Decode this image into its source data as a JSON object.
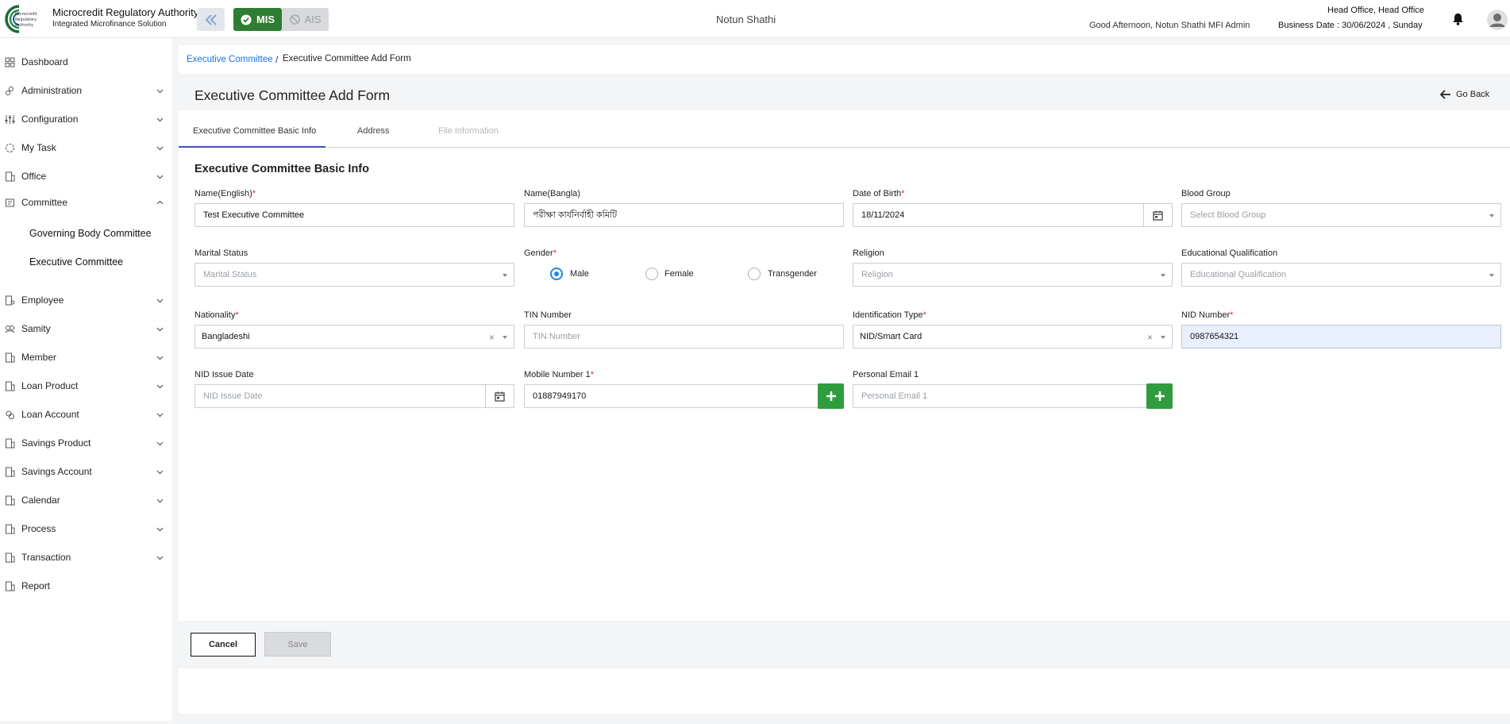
{
  "header": {
    "org_name": "Microcredit Regulatory Authority",
    "org_subtitle": "Integrated Microfinance Solution",
    "logo_text": [
      "Microcredit",
      "Regulatory",
      "Authority"
    ],
    "mis_label": "MIS",
    "ais_label": "AIS",
    "center_title": "Notun Shathi",
    "greeting": "Good Afternoon, Notun Shathi MFI Admin",
    "office": "Head Office, Head Office",
    "business_date": "Business Date : 30/06/2024 , Sunday",
    "accent_color": "#2e7d32"
  },
  "sidebar": {
    "items": [
      {
        "label": "Dashboard",
        "icon": "dashboard-icon"
      },
      {
        "label": "Administration",
        "icon": "admin-icon"
      },
      {
        "label": "Configuration",
        "icon": "config-icon"
      },
      {
        "label": "My Task",
        "icon": "task-icon"
      },
      {
        "label": "Office",
        "icon": "office-icon"
      },
      {
        "label": "Committee",
        "icon": "committee-icon"
      },
      {
        "label": "Employee",
        "icon": "employee-icon"
      },
      {
        "label": "Samity",
        "icon": "samity-icon"
      },
      {
        "label": "Member",
        "icon": "member-icon"
      },
      {
        "label": "Loan Product",
        "icon": "loan-product-icon"
      },
      {
        "label": "Loan Account",
        "icon": "loan-account-icon"
      },
      {
        "label": "Savings Product",
        "icon": "savings-product-icon"
      },
      {
        "label": "Savings Account",
        "icon": "savings-account-icon"
      },
      {
        "label": "Calendar",
        "icon": "calendar-icon"
      },
      {
        "label": "Process",
        "icon": "process-icon"
      },
      {
        "label": "Transaction",
        "icon": "transaction-icon"
      },
      {
        "label": "Report",
        "icon": "report-icon"
      }
    ],
    "committee_sub": [
      "Governing Body Committee",
      "Executive Committee"
    ]
  },
  "breadcrumb": {
    "parent": "Executive Committee",
    "separator": "/",
    "current": "Executive Committee Add Form"
  },
  "page": {
    "title": "Executive Committee Add Form",
    "go_back": "Go Back"
  },
  "tabs": [
    "Executive Committee Basic Info",
    "Address",
    "File Information"
  ],
  "form": {
    "section_title": "Executive Committee Basic Info",
    "name_en": {
      "label": "Name(English)",
      "value": "Test Executive Committee"
    },
    "name_bn": {
      "label": "Name(Bangla)",
      "value": "পরীক্ষা কার্যনির্বাহী কমিটি"
    },
    "dob": {
      "label": "Date of Birth",
      "value": "18/11/2024"
    },
    "blood_group": {
      "label": "Blood Group",
      "placeholder": "Select Blood Group"
    },
    "marital": {
      "label": "Marital Status",
      "placeholder": "Marital Status"
    },
    "gender": {
      "label": "Gender",
      "options": [
        "Male",
        "Female",
        "Transgender"
      ],
      "selected": "Male"
    },
    "religion": {
      "label": "Religion",
      "placeholder": "Religion"
    },
    "education": {
      "label": "Educational Qualification",
      "placeholder": "Educational Qualification"
    },
    "nationality": {
      "label": "Nationality",
      "value": "Bangladeshi"
    },
    "tin": {
      "label": "TIN Number",
      "placeholder": "TIN Number"
    },
    "id_type": {
      "label": "Identification Type",
      "value": "NID/Smart Card"
    },
    "nid": {
      "label": "NID Number",
      "value": "0987654321"
    },
    "nid_issue": {
      "label": "NID Issue Date",
      "placeholder": "NID Issue Date"
    },
    "mobile": {
      "label": "Mobile Number 1",
      "value": "01887949170"
    },
    "email": {
      "label": "Personal Email 1",
      "placeholder": "Personal Email 1"
    },
    "required_mark": "*",
    "clear_symbol": "×"
  },
  "actions": {
    "cancel": "Cancel",
    "save": "Save"
  }
}
